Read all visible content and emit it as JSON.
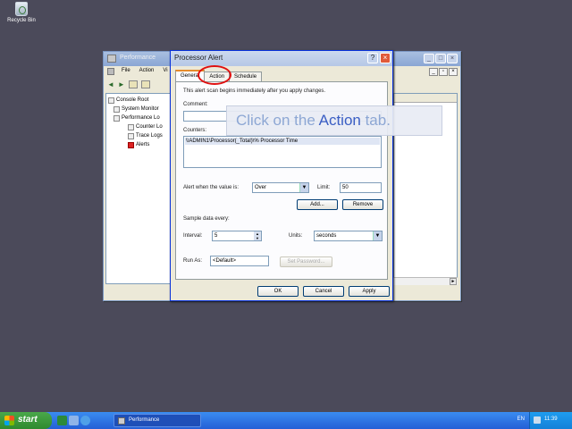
{
  "desktop": {
    "recycle_bin_label": "Recycle Bin"
  },
  "perf_window": {
    "title": "Performance",
    "menu": [
      "File",
      "Action",
      "Vi"
    ],
    "tree": [
      {
        "label": "Console Root",
        "level": 0
      },
      {
        "label": "System Monitor",
        "level": 1
      },
      {
        "label": "Performance Lo",
        "level": 1
      },
      {
        "label": "Counter Lo",
        "level": 2
      },
      {
        "label": "Trace Logs",
        "level": 2
      },
      {
        "label": "Alerts",
        "level": 2
      }
    ]
  },
  "dialog": {
    "title": "Processor Alert",
    "help_glyph": "?",
    "close_glyph": "×",
    "tabs": [
      "General",
      "Action",
      "Schedule"
    ],
    "intro_text": "This alert scan begins immediately after you apply changes.",
    "comment_label": "Comment:",
    "comment_value": "",
    "counters_label": "Counters:",
    "counters": [
      "\\\\ADMIN1\\Processor(_Total)\\% Processor Time"
    ],
    "alert_when_label": "Alert when the value is:",
    "alert_when_value": "Over",
    "limit_label": "Limit:",
    "limit_value": "50",
    "add_button": "Add...",
    "remove_button": "Remove",
    "sample_label": "Sample data every:",
    "interval_label": "Interval:",
    "interval_value": "5",
    "units_label": "Units:",
    "units_value": "seconds",
    "run_as_label": "Run As:",
    "run_as_value": "<Default>",
    "set_password_button": "Set Password...",
    "ok_button": "OK",
    "cancel_button": "Cancel",
    "apply_button": "Apply"
  },
  "callout": {
    "prefix": "Click on the ",
    "highlight": "Action",
    "suffix": " tab."
  },
  "taskbar": {
    "start_label": "start",
    "task_label": "Performance",
    "language": "EN",
    "clock": "11:39"
  },
  "colors": {
    "highlight_circle": "#e01010",
    "callout_text": "#8da7d4",
    "callout_highlight": "#3a5ec4"
  }
}
